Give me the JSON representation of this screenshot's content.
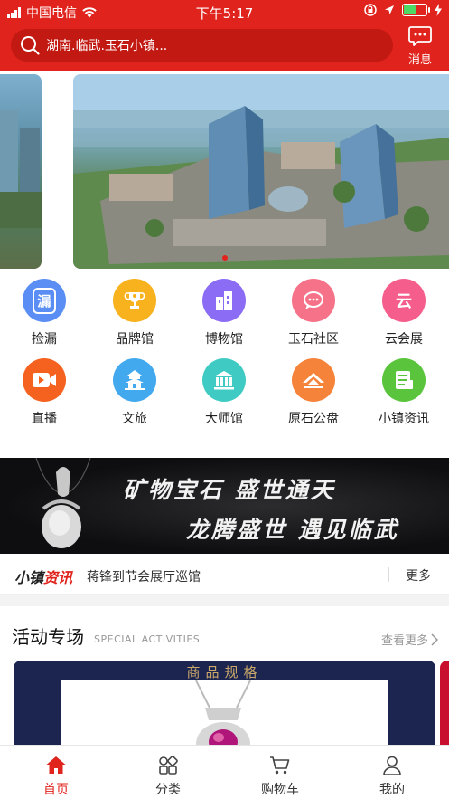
{
  "status_bar": {
    "carrier": "中国电信",
    "time": "下午5:17"
  },
  "header": {
    "search_text": "湖南.临武.玉石小镇...",
    "message_label": "消息"
  },
  "colors": {
    "brand_red": "#e0231c",
    "search_bg": "#c21912"
  },
  "categories": [
    {
      "label": "捡漏",
      "icon": "pick-icon",
      "color": "#5b8ef5",
      "glyph": "漏"
    },
    {
      "label": "品牌馆",
      "icon": "trophy-icon",
      "color": "#f7b21e",
      "glyph": "♛"
    },
    {
      "label": "博物馆",
      "icon": "building-icon",
      "color": "#8b6cf5",
      "glyph": "▥"
    },
    {
      "label": "玉石社区",
      "icon": "chat-bubble-icon",
      "color": "#f57288",
      "glyph": "⋯"
    },
    {
      "label": "云会展",
      "icon": "cloud-expo-icon",
      "color": "#f55d8d",
      "glyph": "云"
    },
    {
      "label": "直播",
      "icon": "video-camera-icon",
      "color": "#f5621f",
      "glyph": "▶"
    },
    {
      "label": "文旅",
      "icon": "pagoda-icon",
      "color": "#42a9ee",
      "glyph": "♙"
    },
    {
      "label": "大师馆",
      "icon": "hall-icon",
      "color": "#3fcbc4",
      "glyph": "▥"
    },
    {
      "label": "原石公盘",
      "icon": "stone-icon",
      "color": "#f5833a",
      "glyph": "△"
    },
    {
      "label": "小镇资讯",
      "icon": "news-icon",
      "color": "#5bc43d",
      "glyph": "☰"
    }
  ],
  "promo": {
    "line1": "矿物宝石 盛世通天",
    "line2": "龙腾盛世 遇见临武"
  },
  "news": {
    "brand_part1": "小镇",
    "brand_part2": "资讯",
    "headline": "蒋锋到节会展厅巡馆",
    "more_label": "更多"
  },
  "activities": {
    "title": "活动专场",
    "subtitle": "SPECIAL ACTIVITIES",
    "more_label": "查看更多",
    "card_header": "商品规格"
  },
  "tabbar": {
    "items": [
      {
        "label": "首页",
        "icon": "home-icon",
        "active": true
      },
      {
        "label": "分类",
        "icon": "category-icon",
        "active": false
      },
      {
        "label": "购物车",
        "icon": "cart-icon",
        "active": false
      },
      {
        "label": "我的",
        "icon": "user-icon",
        "active": false
      }
    ]
  }
}
